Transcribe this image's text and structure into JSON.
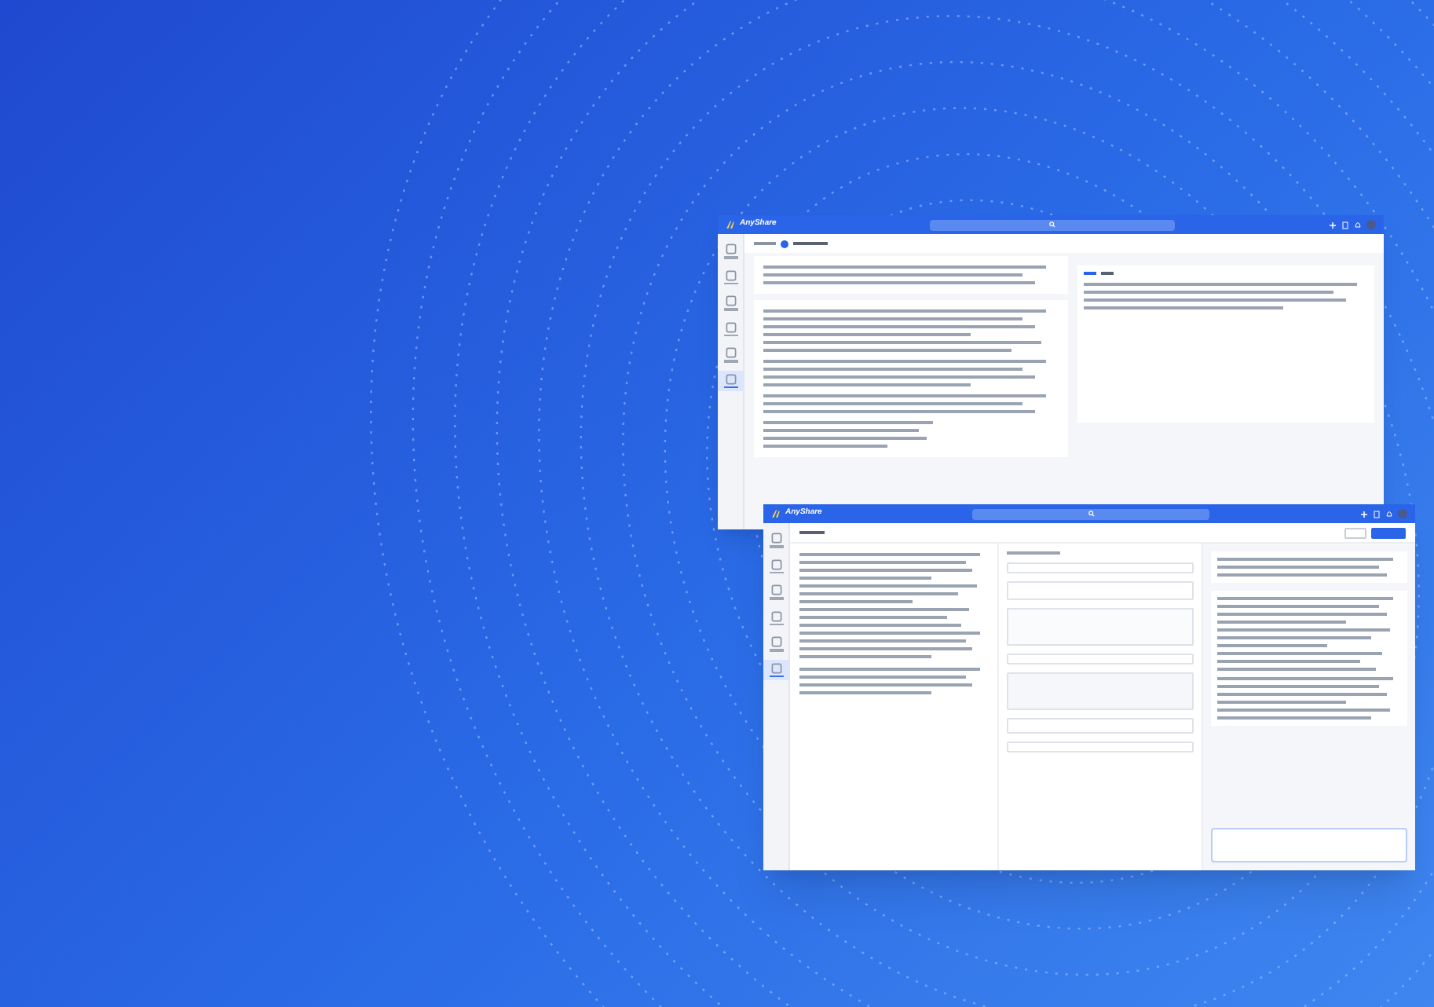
{
  "windows": [
    {
      "app_name": "AnyShare",
      "nav": [
        {
          "selected": false
        },
        {
          "selected": false
        },
        {
          "selected": false
        },
        {
          "selected": false
        },
        {
          "selected": false
        },
        {
          "selected": true
        }
      ]
    },
    {
      "app_name": "AnyShare",
      "nav": [
        {
          "selected": false
        },
        {
          "selected": false
        },
        {
          "selected": false
        },
        {
          "selected": false
        },
        {
          "selected": false
        },
        {
          "selected": true
        }
      ]
    }
  ]
}
